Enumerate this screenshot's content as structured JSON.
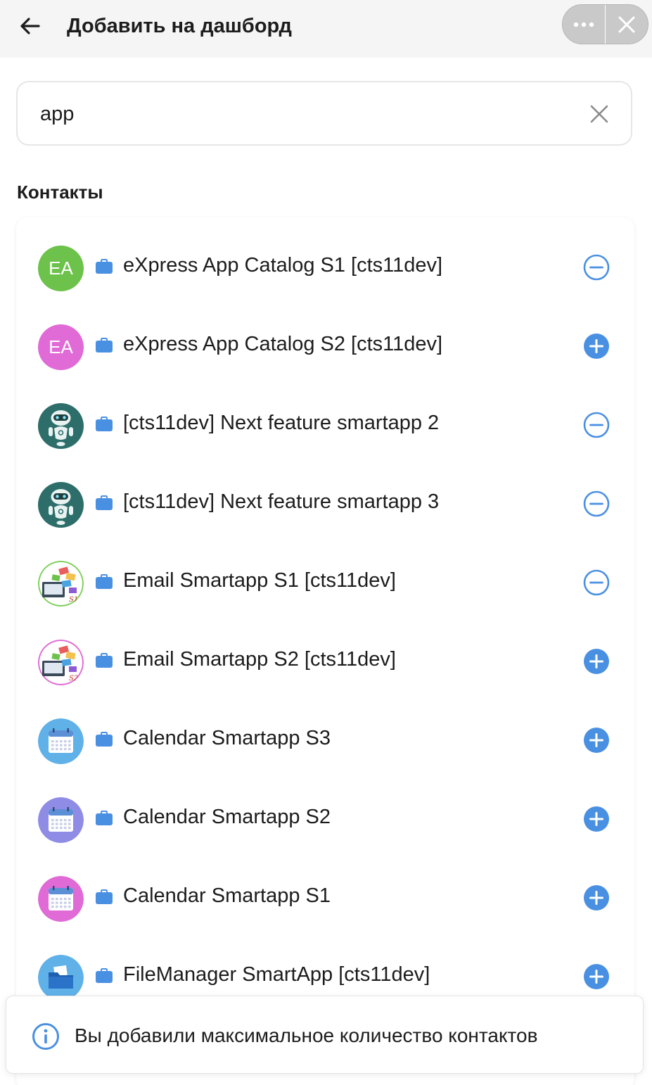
{
  "header": {
    "title": "Добавить на дашборд",
    "back_icon": "arrow-left-icon",
    "more_icon": "more-dots-icon",
    "close_icon": "close-icon"
  },
  "search": {
    "value": "app",
    "clear_icon": "clear-icon"
  },
  "section": {
    "title": "Контакты"
  },
  "colors": {
    "accent": "#4a90e2",
    "header_bg": "#f5f5f5",
    "pill_bg": "#c9c9c9"
  },
  "contacts": [
    {
      "label": "eXpress App Catalog S1 [cts11dev]",
      "avatar": "EA",
      "avatar_color": "#6cc24a",
      "state": "added"
    },
    {
      "label": "eXpress App Catalog S2 [cts11dev]",
      "avatar": "EA",
      "avatar_color": "#e06ad6",
      "state": "not-added"
    },
    {
      "label": "[cts11dev] Next feature smartapp 2",
      "avatar": "robot",
      "avatar_color": "#2d6e6a",
      "state": "added"
    },
    {
      "label": "[cts11dev] Next feature smartapp 3",
      "avatar": "robot",
      "avatar_color": "#2d6e6a",
      "state": "added"
    },
    {
      "label": "Email Smartapp S1 [cts11dev]",
      "avatar": "email-s1",
      "avatar_color": "#7fcf5a",
      "state": "added"
    },
    {
      "label": "Email Smartapp S2 [cts11dev]",
      "avatar": "email-s2",
      "avatar_color": "#e06ad6",
      "state": "not-added"
    },
    {
      "label": "Calendar Smartapp S3",
      "avatar": "calendar",
      "avatar_color": "#5fb1e8",
      "state": "not-added"
    },
    {
      "label": "Calendar Smartapp S2",
      "avatar": "calendar",
      "avatar_color": "#8f8ce6",
      "state": "not-added"
    },
    {
      "label": "Calendar Smartapp S1",
      "avatar": "calendar",
      "avatar_color": "#e06ad6",
      "state": "not-added"
    },
    {
      "label": "FileManager SmartApp [cts11dev]",
      "avatar": "folder",
      "avatar_color": "#5fb1e8",
      "state": "not-added"
    }
  ],
  "toast": {
    "icon": "info-icon",
    "text": "Вы добавили максимальное количество контактов"
  }
}
